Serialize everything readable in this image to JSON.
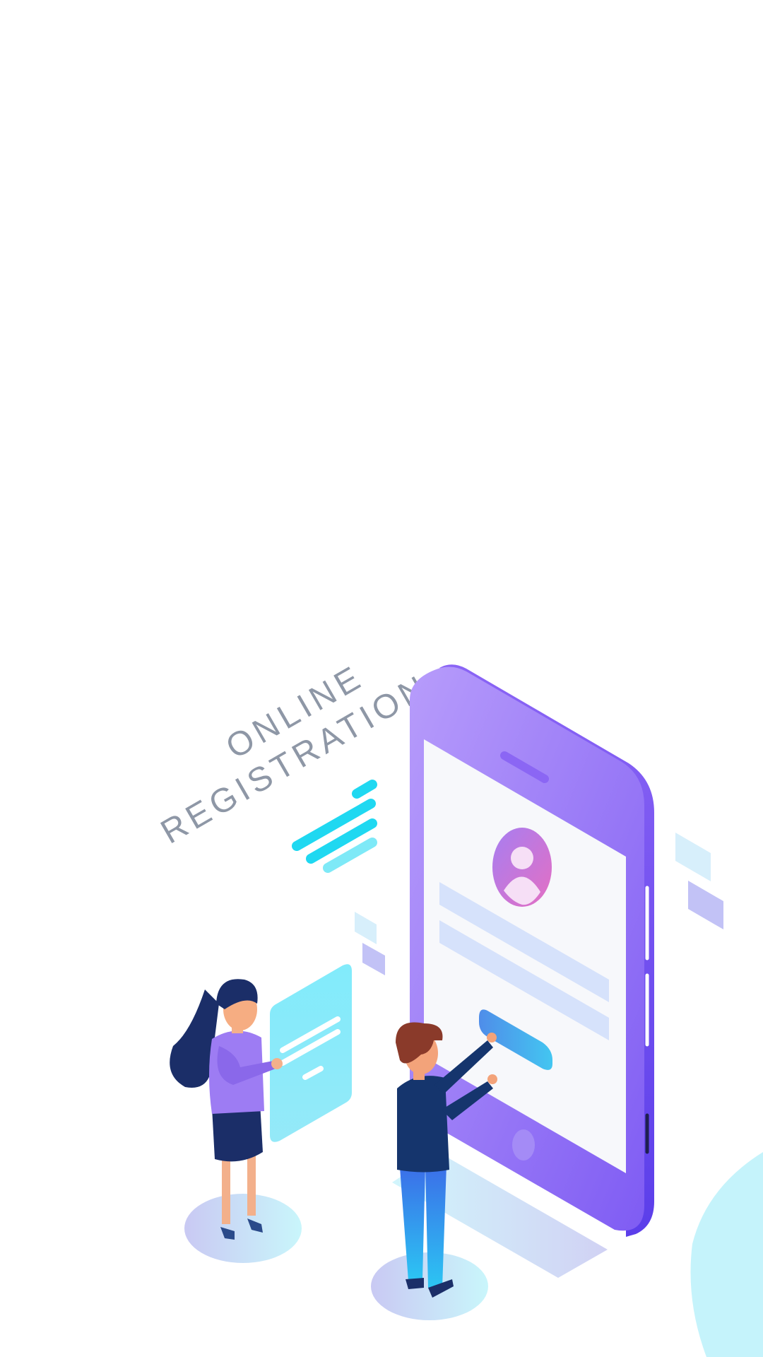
{
  "headline": {
    "line1": "ONLINE",
    "line2": "REGISTRATION"
  },
  "colors": {
    "phone_body": "#9a7cf6",
    "phone_edge": "#6c4cf1",
    "screen": "#f6f7fb",
    "form_field": "#d6e2fb",
    "button": "#4aa8ee",
    "avatar": "#c46fdc",
    "accent_cyan": "#1ad7f0",
    "accent_lavender": "#c5c2f5",
    "woman_hair": "#1d2f6f",
    "woman_top": "#9d7cf3",
    "man_hair": "#8a3a2a",
    "man_top": "#15356d",
    "man_pants": "#2fa8ef",
    "skin": "#f4a87a",
    "blob": "#c5f3fb"
  },
  "icons": {
    "avatar": "user-avatar-icon"
  }
}
